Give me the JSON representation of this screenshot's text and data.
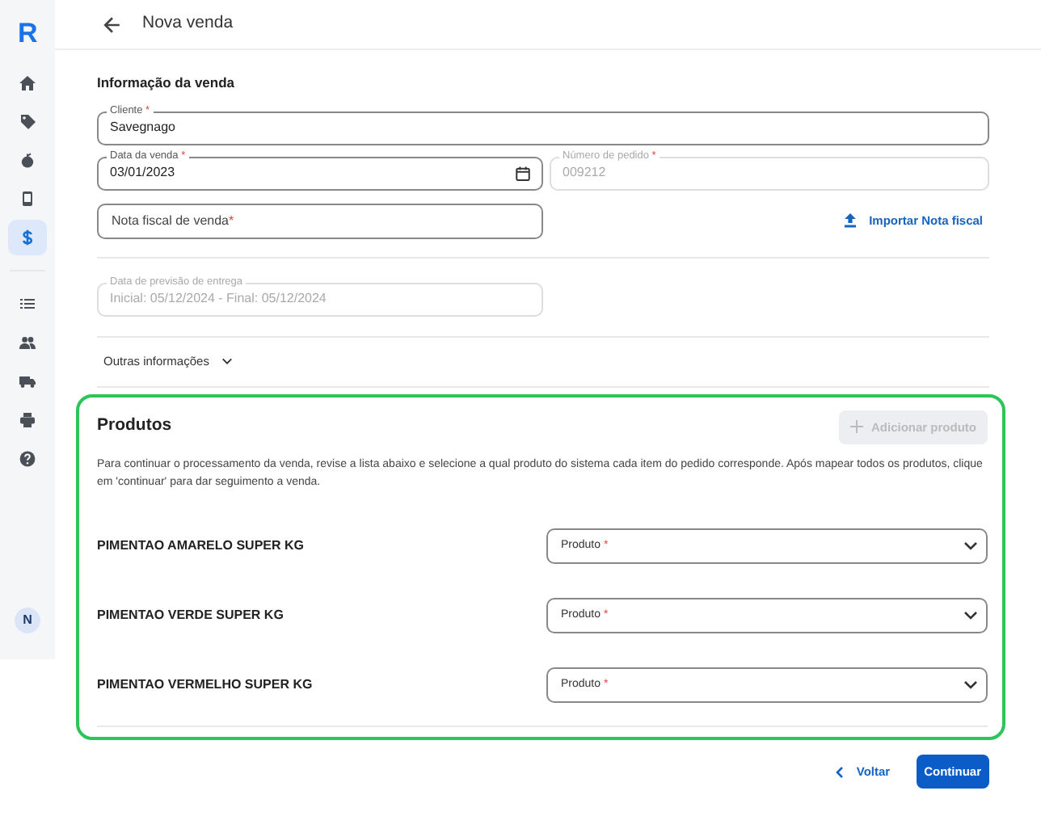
{
  "sidebar": {
    "logo": "R",
    "items": [
      {
        "kind": "home",
        "selected": false
      },
      {
        "kind": "tag",
        "selected": false
      },
      {
        "kind": "fruit",
        "selected": false
      },
      {
        "kind": "device",
        "selected": false
      },
      {
        "kind": "dollar",
        "selected": true
      },
      {
        "kind": "list",
        "selected": false
      },
      {
        "kind": "people",
        "selected": false
      },
      {
        "kind": "truck",
        "selected": false
      },
      {
        "kind": "print",
        "selected": false
      },
      {
        "kind": "help",
        "selected": false
      }
    ],
    "avatar": "N"
  },
  "header": {
    "title": "Nova venda"
  },
  "section_title": "Informação da venda",
  "fields": [
    {
      "label": "Cliente",
      "required_mark": "*",
      "value": "Savegnago",
      "disabled": false,
      "kind": "text"
    },
    {
      "label": "Data da venda",
      "required_mark": "*",
      "value": "03/01/2023",
      "disabled": false,
      "kind": "date"
    },
    {
      "label": "Número de pedido",
      "required_mark": "*",
      "value": "009212",
      "disabled": true,
      "kind": "text"
    },
    {
      "label": "Nota fiscal de venda",
      "required_mark": "*",
      "disabled": false,
      "kind": "text"
    },
    {
      "label": "Data de previsão de entrega",
      "value": "Inicial: 05/12/2024 - Final: 05/12/2024",
      "disabled": true,
      "kind": "text"
    }
  ],
  "import_link": "Importar Nota fiscal",
  "other_info": {
    "label": "Outras informações",
    "expanded": false
  },
  "products": {
    "title": "Produtos",
    "add_button": {
      "label": "Adicionar produto",
      "disabled": true
    },
    "description": "Para continuar o processamento da venda, revise a lista abaixo e selecione a qual produto do sistema cada item do pedido corresponde. Após mapear todos os produtos, clique em 'continuar' para dar seguimento a venda.",
    "items": [
      {
        "name": "PIMENTAO AMARELO SUPER KG",
        "select_label": "Produto",
        "required_mark": "*"
      },
      {
        "name": "PIMENTAO VERDE SUPER KG",
        "select_label": "Produto",
        "required_mark": "*"
      },
      {
        "name": "PIMENTAO VERMELHO SUPER KG",
        "select_label": "Produto",
        "required_mark": "*"
      }
    ]
  },
  "footer": {
    "back": "Voltar",
    "continue": "Continuar"
  }
}
